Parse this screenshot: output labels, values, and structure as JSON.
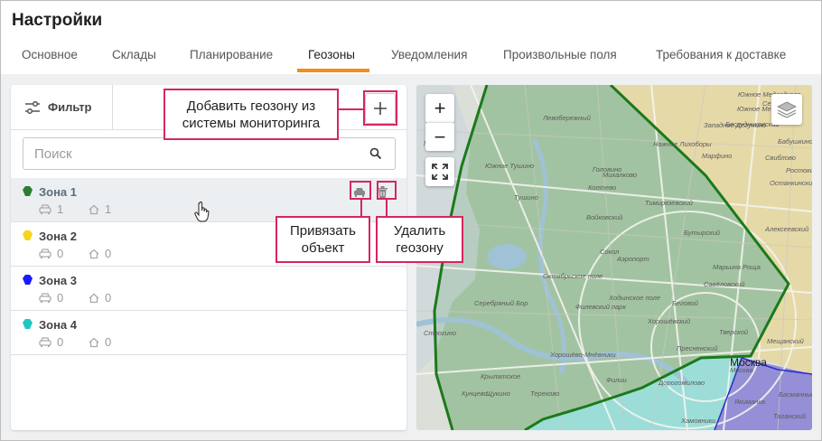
{
  "header": {
    "title": "Настройки"
  },
  "tabs": [
    {
      "label": "Основное"
    },
    {
      "label": "Склады"
    },
    {
      "label": "Планирование"
    },
    {
      "label": "Геозоны"
    },
    {
      "label": "Уведомления"
    },
    {
      "label": "Произвольные поля"
    },
    {
      "label": "Требования к доставке"
    }
  ],
  "active_tab": "Геозоны",
  "toolbar": {
    "filter_label": "Фильтр"
  },
  "search": {
    "placeholder": "Поиск"
  },
  "zones": [
    {
      "name": "Зона 1",
      "vehicles": "1",
      "warehouses": "1",
      "color": "#2e7d32"
    },
    {
      "name": "Зона 2",
      "vehicles": "0",
      "warehouses": "0",
      "color": "#f7d417"
    },
    {
      "name": "Зона 3",
      "vehicles": "0",
      "warehouses": "0",
      "color": "#1a1aff"
    },
    {
      "name": "Зона 4",
      "vehicles": "0",
      "warehouses": "0",
      "color": "#1ec7c0"
    }
  ],
  "callouts": {
    "add": "Добавить геозону из системы мониторинга",
    "bind": "Привязать объект",
    "delete": "Удалить геозону"
  },
  "map": {
    "zoom_in": "+",
    "zoom_out": "−",
    "labels": [
      "Левобережный",
      "Михалково",
      "Нажние Лихоборы",
      "Западное Дегунино",
      "Южное Медведково",
      "Южное Тушино",
      "Головино",
      "Коптево",
      "Тушино",
      "Войковский",
      "Бескудниковский",
      "Сокол",
      "Аэропорт",
      "Бутырский",
      "Марьина Роща",
      "Пресненский",
      "Хорошёвский",
      "Хорошёво-Мнёвники",
      "Беговой",
      "Тверской",
      "Филевский парк",
      "Щукино",
      "Крылатское",
      "Москва",
      "Якиманка",
      "Хамовники",
      "Кунцево",
      "Дорогомилово",
      "Серебряный Бор",
      "Строгино",
      "Митино",
      "Останкинский",
      "Алексеевский",
      "Ростокинский",
      "Северный",
      "Бабушкинский",
      "Свиблово",
      "Филии",
      "Терехово",
      "Октябрьское поле",
      "Ходынское поле",
      "Таганский",
      "Басманный",
      "Мещанский",
      "Марфино",
      "Савёловский",
      "Тимирязевский",
      "Южное Медведково"
    ]
  }
}
